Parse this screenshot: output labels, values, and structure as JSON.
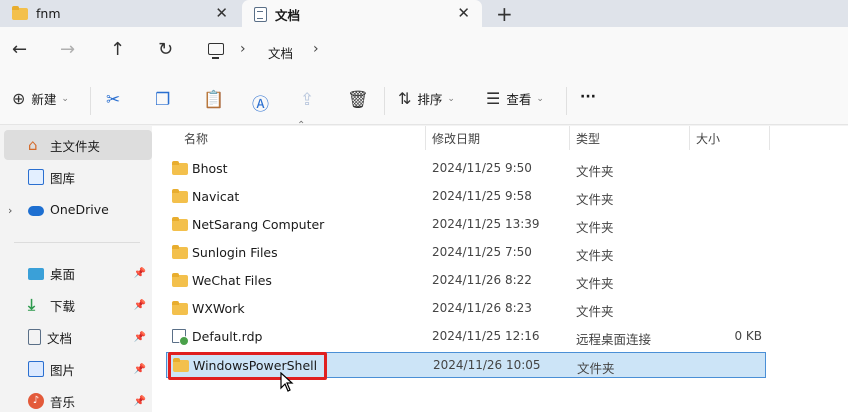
{
  "tabs": [
    {
      "label": "fnm",
      "icon": "folder-icon"
    },
    {
      "label": "文档",
      "icon": "document-icon"
    }
  ],
  "tab_new": "+",
  "tab_close": "✕",
  "nav": {
    "back": "←",
    "forward": "→",
    "up": "↑",
    "refresh": "↻",
    "breadcrumb": [
      "文档"
    ],
    "sep": "›"
  },
  "toolbar": {
    "new_label": "新建",
    "sort_label": "排序",
    "view_label": "查看",
    "more_label": "···"
  },
  "sidebar": {
    "items": [
      {
        "label": "主文件夹",
        "icon": "home-icon",
        "selected": true
      },
      {
        "label": "图库",
        "icon": "gallery-icon"
      },
      {
        "label": "OneDrive",
        "icon": "onedrive-icon",
        "expander": "›"
      },
      {
        "label": "桌面",
        "icon": "desktop-icon",
        "pinned": true
      },
      {
        "label": "下载",
        "icon": "download-icon",
        "pinned": true
      },
      {
        "label": "文档",
        "icon": "documents-icon",
        "pinned": true
      },
      {
        "label": "图片",
        "icon": "pictures-icon",
        "pinned": true
      },
      {
        "label": "音乐",
        "icon": "music-icon",
        "pinned": true
      }
    ]
  },
  "columns": {
    "name": "名称",
    "date": "修改日期",
    "type": "类型",
    "size": "大小"
  },
  "files": [
    {
      "name": "Bhost",
      "date": "2024/11/25 9:50",
      "type": "文件夹",
      "size": ""
    },
    {
      "name": "Navicat",
      "date": "2024/11/25 9:58",
      "type": "文件夹",
      "size": ""
    },
    {
      "name": "NetSarang Computer",
      "date": "2024/11/25 13:39",
      "type": "文件夹",
      "size": ""
    },
    {
      "name": "Sunlogin Files",
      "date": "2024/11/25 7:50",
      "type": "文件夹",
      "size": ""
    },
    {
      "name": "WeChat Files",
      "date": "2024/11/26 8:22",
      "type": "文件夹",
      "size": ""
    },
    {
      "name": "WXWork",
      "date": "2024/11/26 8:23",
      "type": "文件夹",
      "size": ""
    },
    {
      "name": "Default.rdp",
      "date": "2024/11/25 12:16",
      "type": "远程桌面连接",
      "size": "0 KB"
    },
    {
      "name": "WindowsPowerShell",
      "date": "2024/11/26 10:05",
      "type": "文件夹",
      "size": "",
      "selected": true
    }
  ],
  "colors": {
    "accent": "#2a6fd0",
    "selection": "#cce4f7",
    "highlight": "#e02020",
    "folder": "#f3c04c"
  }
}
